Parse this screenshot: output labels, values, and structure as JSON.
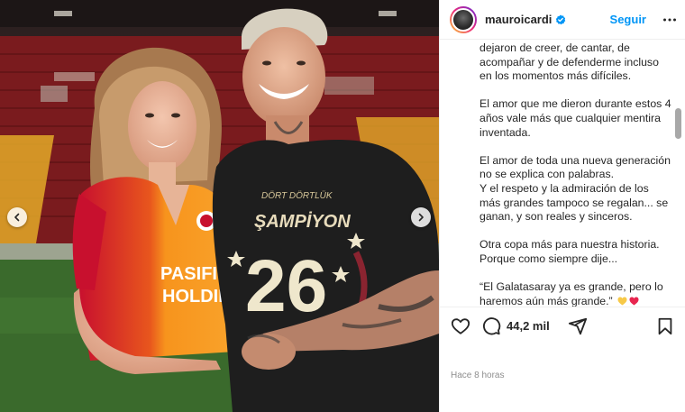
{
  "post": {
    "username": "mauroicardi",
    "follow_label": "Seguir",
    "caption": [
      "dejaron de creer, de cantar, de acompañar y de defenderme incluso en los momentos más difíciles.",
      "El amor que me dieron durante estos 4 años vale más que cualquier mentira inventada.",
      "El amor de toda una nueva generación no se explica con palabras.\nY el respeto y la admiración de los más grandes tampoco se regalan... se ganan, y son reales y sinceros.",
      "Otra copa más para nuestra historia. Porque como siempre dije...",
      "“El Galatasaray ya es grande, pero lo haremos aún más grande.”"
    ],
    "comment_count": "44,2 mil",
    "timestamp": "Hace 8 horas"
  },
  "photo": {
    "jersey_brand": "PASIFIK HOLDING",
    "shirt_text_top": "DÖRT DÖRTLÜK",
    "shirt_text_main": "ŞAMPİYON",
    "shirt_number": "26"
  },
  "icons": {
    "verified": "verified-badge-icon",
    "more": "more-options-icon",
    "like": "heart-icon",
    "comment": "comment-icon",
    "share": "share-icon",
    "save": "bookmark-icon",
    "prev": "chevron-left-icon",
    "next": "chevron-right-icon"
  },
  "colors": {
    "accent": "#0095f6",
    "jersey_orange": "#f7941d",
    "jersey_red": "#c8102e",
    "emoji_yellow": "#f7c948",
    "emoji_red": "#e8254f"
  }
}
